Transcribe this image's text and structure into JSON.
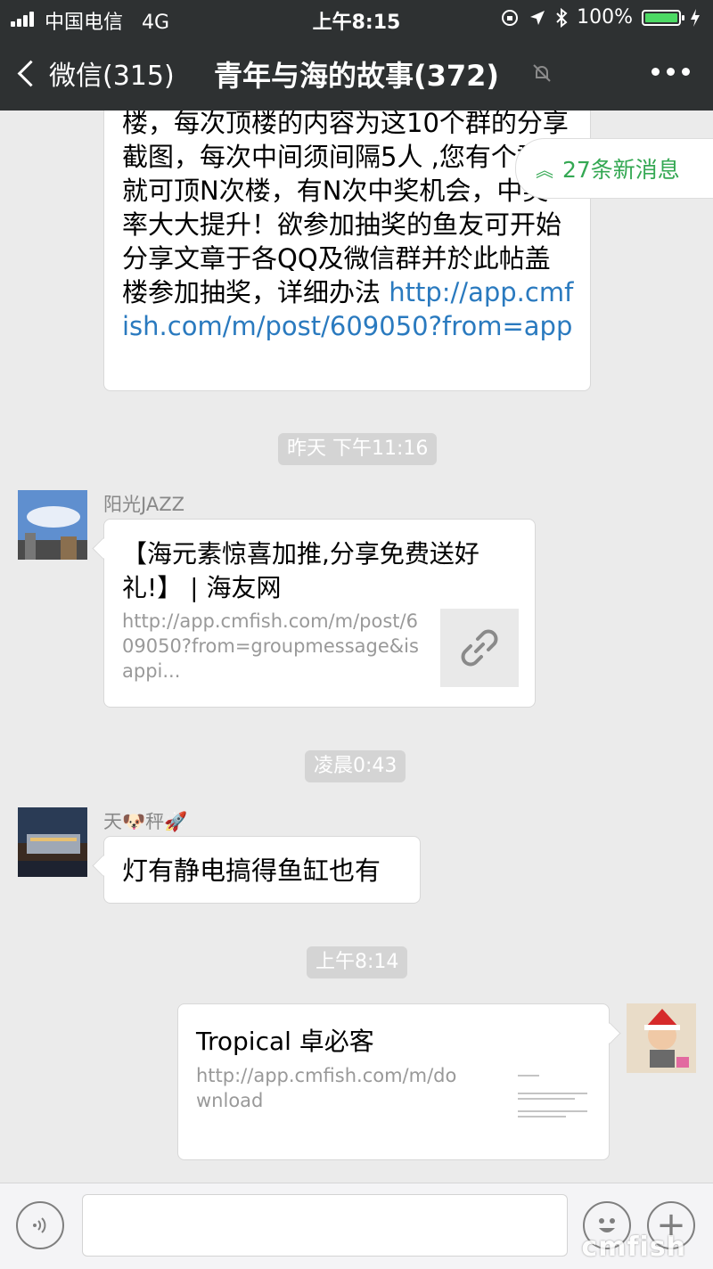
{
  "status_bar": {
    "carrier": "中国电信",
    "network": "4G",
    "time": "上午8:15",
    "battery_percent": "100%"
  },
  "nav": {
    "back_label": "微信(315)",
    "title": "青年与海的故事(372)"
  },
  "new_messages_label": "27条新消息",
  "messages": {
    "long_text_partial": "楼，每次顶楼的内容为这10个群的分享截图，每次中间须间隔5人 ,您有个群，就可顶N次楼，有N次中奖机会，中奖率大大提升！欲参加抽奖的鱼友可开始分享文章于各QQ及微信群并於此帖盖楼参加抽奖，详细办法",
    "long_text_link": "http://app.cmfish.com/m/post/609050?from=app",
    "time_1": "昨天 下午11:16",
    "sender_1": "阳光JAZZ",
    "link_card": {
      "title": "【海元素惊喜加推,分享免费送好礼!】 | 海友网",
      "url": "http://app.cmfish.com/m/post/609050?from=groupmessage&isappi..."
    },
    "time_2": "凌晨0:43",
    "sender_2": "天🐶秤🚀",
    "text_3": "灯有静电搞得鱼缸也有",
    "time_3": "上午8:14",
    "own_card": {
      "title": "Tropical 卓必客",
      "url": "http://app.cmfish.com/m/download"
    }
  },
  "watermark": "cmfish"
}
